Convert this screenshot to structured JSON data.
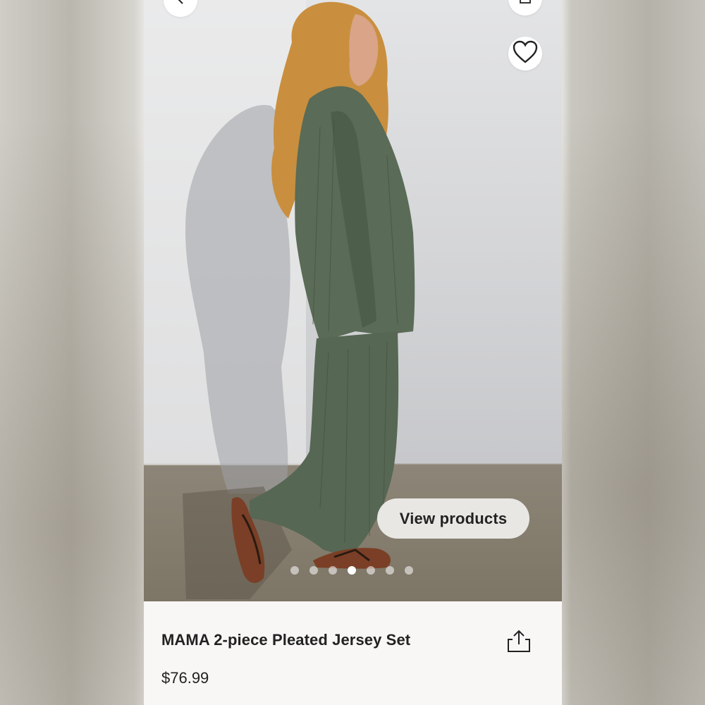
{
  "product": {
    "title": "MAMA 2-piece Pleated Jersey Set",
    "price": "$76.99"
  },
  "gallery": {
    "view_products_label": "View products",
    "total_images": 7,
    "active_index": 4
  },
  "icons": {
    "back": "chevron-left-icon",
    "bag": "shopping-bag-icon",
    "favorite": "heart-outline-icon",
    "share": "share-icon"
  },
  "colors": {
    "outfit_green": "#5a6b57",
    "text": "#222222",
    "panel": "#f8f7f5"
  }
}
